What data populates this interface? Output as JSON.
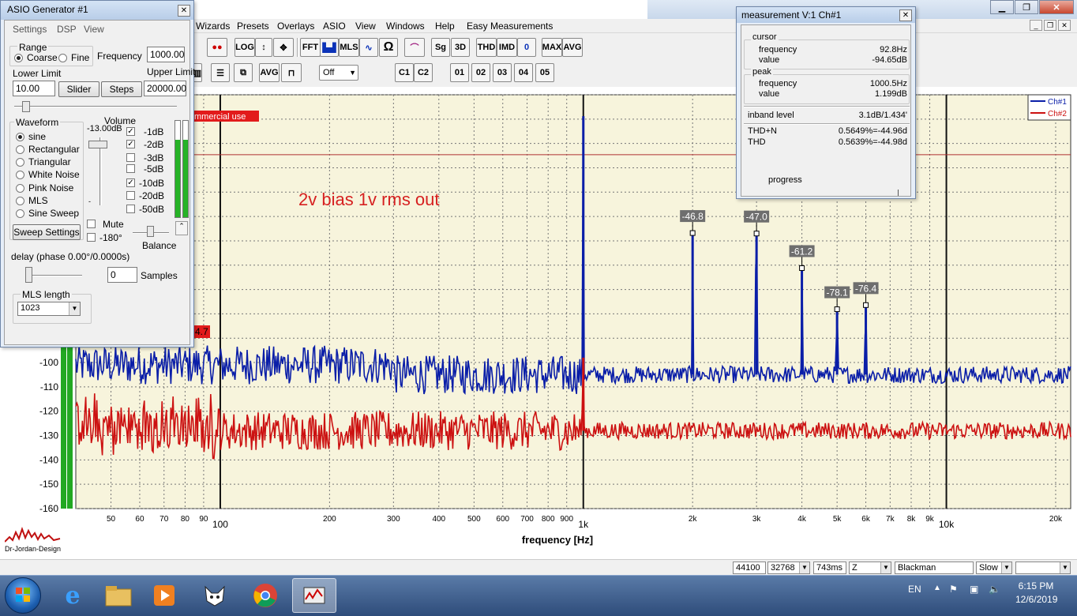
{
  "app": {
    "menu": [
      "Wizards",
      "Presets",
      "Overlays",
      "ASIO",
      "View",
      "Windows",
      "Help",
      "Easy Measurements"
    ],
    "toolbar_row1": [
      "LOG",
      "FFT",
      "MLS",
      "Sg",
      "3D",
      "THD",
      "IMD",
      "0",
      "MAX",
      "AVG"
    ],
    "toolbar_row2": [
      "AVG",
      "Off",
      "C1",
      "C2",
      "01",
      "02",
      "03",
      "04",
      "05"
    ]
  },
  "generator": {
    "title": "ASIO Generator #1",
    "menu": [
      "Settings",
      "DSP",
      "View"
    ],
    "range_label": "Range",
    "coarse": "Coarse",
    "fine": "Fine",
    "frequency_label": "Frequency",
    "frequency_value": "1000.00",
    "lower_limit_label": "Lower Limit",
    "lower_limit_value": "10.00",
    "upper_limit_label": "Upper Limit",
    "upper_limit_value": "20000.00",
    "slider_btn": "Slider",
    "steps_btn": "Steps",
    "waveform_label": "Waveform",
    "waveforms": [
      "sine",
      "Rectangular",
      "Triangular",
      "White Noise",
      "Pink Noise",
      "MLS",
      "Sine Sweep"
    ],
    "selected_waveform": "sine",
    "sweep_settings": "Sweep Settings",
    "volume_label": "Volume",
    "volume_value": "-13.00dB",
    "db_steps": [
      {
        "label": "-1dB",
        "checked": true
      },
      {
        "label": "-2dB",
        "checked": true
      },
      {
        "label": "-3dB",
        "checked": false
      },
      {
        "label": "-5dB",
        "checked": false
      },
      {
        "label": "-10dB",
        "checked": true
      },
      {
        "label": "-20dB",
        "checked": false
      },
      {
        "label": "-50dB",
        "checked": false
      }
    ],
    "mute": "Mute",
    "invert": "-180°",
    "balance": "Balance",
    "delay_label": "delay (phase  0.00°/0.0000s)",
    "samples_value": "0",
    "samples_label": "Samples",
    "mls_length_label": "MLS length",
    "mls_length_value": "1023",
    "volume_bar_level": 0.8
  },
  "measurement": {
    "title": "measurement V:1 Ch#1",
    "cursor_label": "cursor",
    "cursor_frequency_label": "frequency",
    "cursor_frequency": "92.8Hz",
    "cursor_value_label": "value",
    "cursor_value": "-94.65dB",
    "peak_label": "peak",
    "peak_frequency_label": "frequency",
    "peak_frequency": "1000.5Hz",
    "peak_value_label": "value",
    "peak_value": "1.199dB",
    "inband_label": "inband level",
    "inband_value": "3.1dB/1.434'",
    "thdn_label": "THD+N",
    "thdn_value": "0.5649%=-44.96d",
    "thd_label": "THD",
    "thd_value": "0.5639%=-44.98d",
    "progress_label": "progress"
  },
  "chart_data": {
    "type": "line",
    "xlabel": "frequency [Hz]",
    "xscale": "log",
    "xlim": [
      40,
      22000
    ],
    "ylim": [
      -160,
      10
    ],
    "y_ticks": [
      -100,
      -110,
      -120,
      -130,
      -140,
      -150,
      -160
    ],
    "x_ticks": [
      {
        "v": 50,
        "label": "50"
      },
      {
        "v": 60,
        "label": "60"
      },
      {
        "v": 70,
        "label": "70"
      },
      {
        "v": 80,
        "label": "80"
      },
      {
        "v": 90,
        "label": "90"
      },
      {
        "v": 100,
        "label": "100",
        "major": true
      },
      {
        "v": 200,
        "label": "200"
      },
      {
        "v": 300,
        "label": "300"
      },
      {
        "v": 400,
        "label": "400"
      },
      {
        "v": 500,
        "label": "500"
      },
      {
        "v": 600,
        "label": "600"
      },
      {
        "v": 700,
        "label": "700"
      },
      {
        "v": 800,
        "label": "800"
      },
      {
        "v": 900,
        "label": "900"
      },
      {
        "v": 1000,
        "label": "1k",
        "major": true
      },
      {
        "v": 2000,
        "label": "2k"
      },
      {
        "v": 3000,
        "label": "3k"
      },
      {
        "v": 4000,
        "label": "4k"
      },
      {
        "v": 5000,
        "label": "5k"
      },
      {
        "v": 6000,
        "label": "6k"
      },
      {
        "v": 7000,
        "label": "7k"
      },
      {
        "v": 8000,
        "label": "8k"
      },
      {
        "v": 9000,
        "label": "9k"
      },
      {
        "v": 10000,
        "label": "10k",
        "major": true
      },
      {
        "v": 20000,
        "label": "20k"
      }
    ],
    "legend": [
      "Ch#1",
      "Ch#2"
    ],
    "legend_position": "top-right",
    "series": [
      {
        "name": "Ch#1",
        "color": "#0a1ea8",
        "noise_floor": -105,
        "harmonics": [
          {
            "f": 1000,
            "db": 1.2
          },
          {
            "f": 2000,
            "db": -46.8
          },
          {
            "f": 3000,
            "db": -47.0
          },
          {
            "f": 4000,
            "db": -61.2
          },
          {
            "f": 5000,
            "db": -78.1
          },
          {
            "f": 6000,
            "db": -76.4
          }
        ]
      },
      {
        "name": "Ch#2",
        "color": "#cc1111",
        "noise_floor": -128,
        "harmonics": [
          {
            "f": 1000,
            "db": -98
          }
        ]
      }
    ],
    "peak_labels": [
      {
        "f": 2000,
        "db": -46.8,
        "label": "-46.8"
      },
      {
        "f": 3000,
        "db": -47.0,
        "label": "-47.0"
      },
      {
        "f": 4000,
        "db": -61.2,
        "label": "-61.2"
      },
      {
        "f": 5000,
        "db": -78.1,
        "label": "-78.1"
      },
      {
        "f": 6000,
        "db": -76.4,
        "label": "-76.4"
      }
    ],
    "annotation": "2v bias 1v rms out",
    "watermark": "mmercial use",
    "left_marker": "4.7",
    "reference_line_db": 0
  },
  "status": {
    "samplerate": "44100",
    "fftsize": "32768",
    "time": "743ms",
    "z": "Z",
    "window": "Blackman",
    "speed": "Slow"
  },
  "taskbar": {
    "lang": "EN",
    "time": "6:15 PM",
    "date": "12/6/2019"
  },
  "brand": "Dr-Jordan-Design"
}
